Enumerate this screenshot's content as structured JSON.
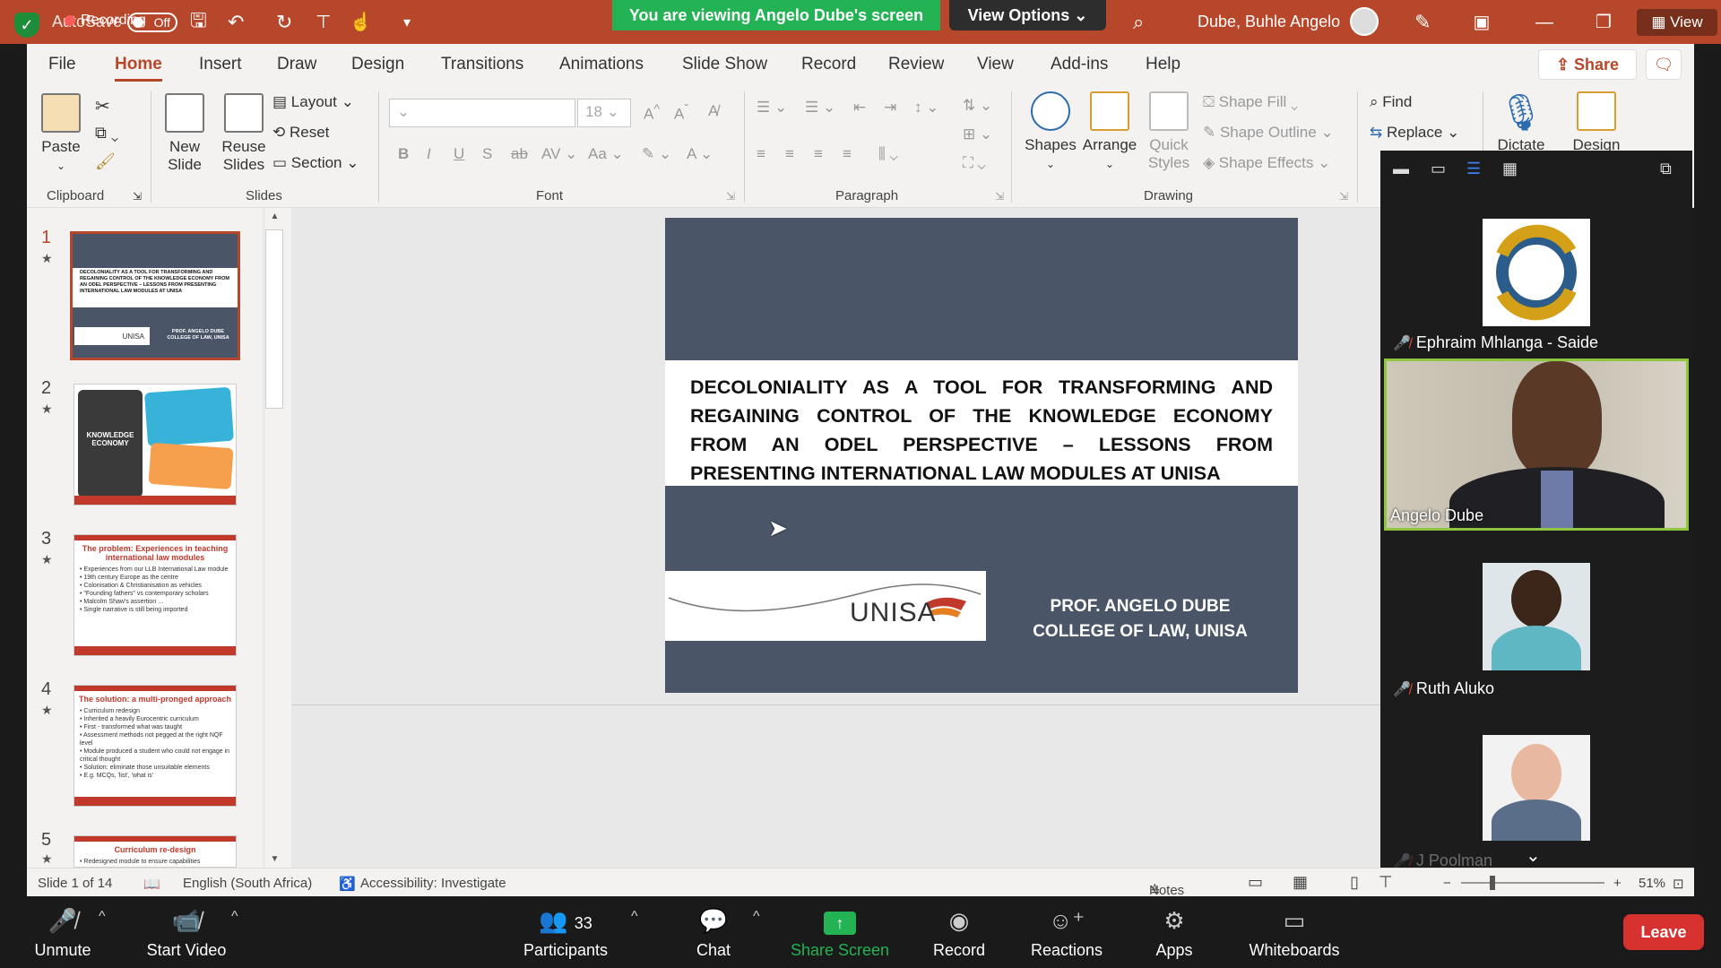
{
  "titlebar": {
    "autosave_label": "AutoSave",
    "autosave_state": "Off",
    "recording_label": "Recording",
    "viewing_banner": "You are viewing Angelo Dube's screen",
    "view_options": "View Options",
    "user_name": "Dube, Buhle Angelo",
    "view_label": "View"
  },
  "tabs": [
    "File",
    "Home",
    "Insert",
    "Draw",
    "Design",
    "Transitions",
    "Animations",
    "Slide Show",
    "Record",
    "Review",
    "View",
    "Add-ins",
    "Help"
  ],
  "active_tab": "Home",
  "share_label": "Share",
  "ribbon": {
    "clipboard": {
      "label": "Clipboard",
      "paste": "Paste"
    },
    "slides": {
      "label": "Slides",
      "new_slide": "New Slide",
      "reuse_slides": "Reuse Slides",
      "layout": "Layout",
      "reset": "Reset",
      "section": "Section"
    },
    "font": {
      "label": "Font",
      "size": "18"
    },
    "paragraph": {
      "label": "Paragraph"
    },
    "drawing": {
      "label": "Drawing",
      "shapes": "Shapes",
      "arrange": "Arrange",
      "quick_styles": "Quick Styles",
      "shape_fill": "Shape Fill",
      "shape_outline": "Shape Outline",
      "shape_effects": "Shape Effects"
    },
    "editing": {
      "find": "Find",
      "replace": "Replace"
    },
    "voice": {
      "dictate": "Dictate"
    },
    "designer": {
      "design": "Design"
    }
  },
  "thumbnails": [
    {
      "num": "1",
      "title": "DECOLONIALITY AS A TOOL FOR TRANSFORMING AND REGAINING CONTROL OF THE KNOWLEDGE ECONOMY FROM AN ODEL PERSPECTIVE – LESSONS FROM PRESENTING INTERNATIONAL LAW MODULES AT UNISA"
    },
    {
      "num": "2",
      "title": "KNOWLEDGE ECONOMY"
    },
    {
      "num": "3",
      "title": "The problem: Experiences in teaching international law modules"
    },
    {
      "num": "4",
      "title": "The solution: a multi-pronged approach"
    },
    {
      "num": "5",
      "title": "Curriculum re-design"
    }
  ],
  "slide": {
    "title": "DECOLONIALITY AS A TOOL FOR TRANSFORMING AND REGAINING CONTROL OF THE KNOWLEDGE ECONOMY FROM AN ODEL PERSPECTIVE – LESSONS FROM PRESENTING INTERNATIONAL LAW MODULES AT UNISA",
    "logo_text": "UNISA",
    "author_line1": "PROF. ANGELO DUBE",
    "author_line2": "COLLEGE OF LAW, UNISA"
  },
  "participants": [
    {
      "name": "Ephraim Mhlanga - Saide",
      "muted": true
    },
    {
      "name": "Angelo Dube",
      "muted": false,
      "active": true
    },
    {
      "name": "Ruth Aluko",
      "muted": true
    },
    {
      "name": "J Poolman",
      "muted": true
    }
  ],
  "statusbar": {
    "slide_info": "Slide 1 of 14",
    "language": "English (South Africa)",
    "accessibility": "Accessibility: Investigate",
    "notes": "Notes",
    "zoom": "51%"
  },
  "zoombar": {
    "unmute": "Unmute",
    "start_video": "Start Video",
    "participants": "Participants",
    "participant_count": "33",
    "chat": "Chat",
    "share_screen": "Share Screen",
    "record": "Record",
    "reactions": "Reactions",
    "apps": "Apps",
    "whiteboards": "Whiteboards",
    "leave": "Leave"
  },
  "colors": {
    "accent": "#b7472a",
    "slide_bg": "#4a5568",
    "banner_green": "#23b254",
    "leave_red": "#d7322f",
    "speaker_border": "#8ec63f"
  }
}
